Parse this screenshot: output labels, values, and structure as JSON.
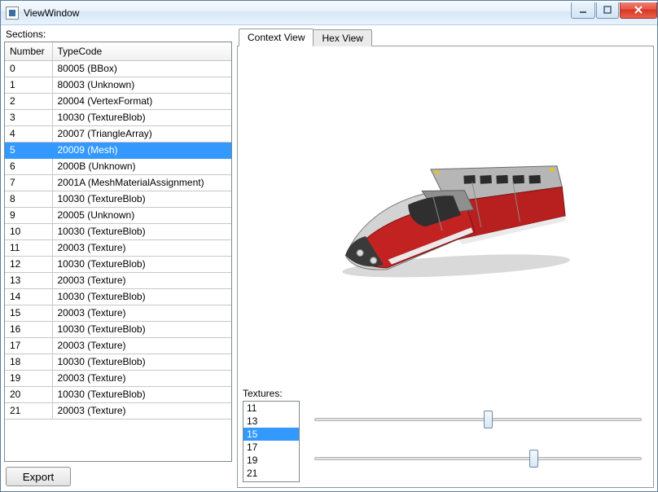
{
  "window": {
    "title": "ViewWindow"
  },
  "left": {
    "label": "Sections:",
    "columns": {
      "number": "Number",
      "typecode": "TypeCode"
    },
    "rows": [
      {
        "n": "0",
        "tc": "80005 (BBox)"
      },
      {
        "n": "1",
        "tc": "80003 (Unknown)"
      },
      {
        "n": "2",
        "tc": "20004 (VertexFormat)"
      },
      {
        "n": "3",
        "tc": "10030 (TextureBlob)"
      },
      {
        "n": "4",
        "tc": "20007 (TriangleArray)"
      },
      {
        "n": "5",
        "tc": "20009 (Mesh)"
      },
      {
        "n": "6",
        "tc": "2000B (Unknown)"
      },
      {
        "n": "7",
        "tc": "2001A (MeshMaterialAssignment)"
      },
      {
        "n": "8",
        "tc": "10030 (TextureBlob)"
      },
      {
        "n": "9",
        "tc": "20005 (Unknown)"
      },
      {
        "n": "10",
        "tc": "10030 (TextureBlob)"
      },
      {
        "n": "11",
        "tc": "20003 (Texture)"
      },
      {
        "n": "12",
        "tc": "10030 (TextureBlob)"
      },
      {
        "n": "13",
        "tc": "20003 (Texture)"
      },
      {
        "n": "14",
        "tc": "10030 (TextureBlob)"
      },
      {
        "n": "15",
        "tc": "20003 (Texture)"
      },
      {
        "n": "16",
        "tc": "10030 (TextureBlob)"
      },
      {
        "n": "17",
        "tc": "20003 (Texture)"
      },
      {
        "n": "18",
        "tc": "10030 (TextureBlob)"
      },
      {
        "n": "19",
        "tc": "20003 (Texture)"
      },
      {
        "n": "20",
        "tc": "10030 (TextureBlob)"
      },
      {
        "n": "21",
        "tc": "20003 (Texture)"
      }
    ],
    "selected_index": 5,
    "export_label": "Export"
  },
  "tabs": {
    "items": [
      {
        "label": "Context View"
      },
      {
        "label": "Hex View"
      }
    ],
    "active_index": 0
  },
  "textures": {
    "label": "Textures:",
    "items": [
      "11",
      "13",
      "15",
      "17",
      "19",
      "21"
    ],
    "selected_index": 2
  },
  "sliders": {
    "s1_percent": 53,
    "s2_percent": 67
  }
}
